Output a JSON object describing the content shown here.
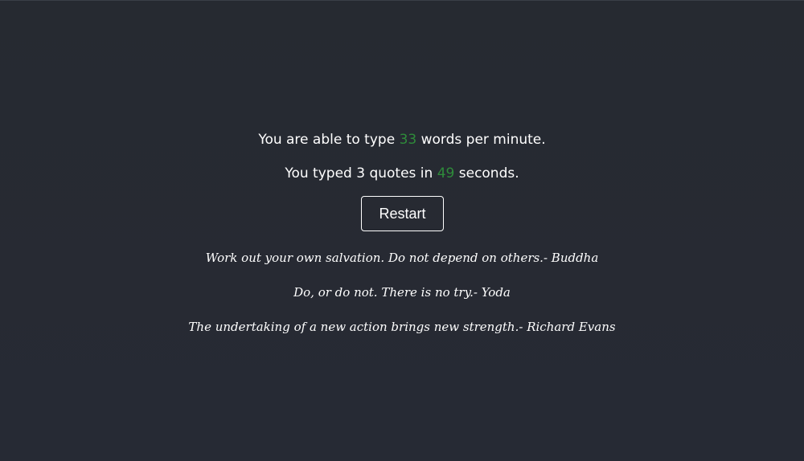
{
  "results": {
    "wpm_prefix": "You are able to type ",
    "wpm_value": "33",
    "wpm_suffix": " words per minute.",
    "time_prefix": "You typed 3 quotes in ",
    "time_value": "49",
    "time_suffix": " seconds."
  },
  "restart_label": "Restart",
  "quotes": [
    {
      "text": "Work out your own salvation. Do not depend on others.",
      "author": "- Buddha"
    },
    {
      "text": "Do, or do not. There is no try.",
      "author": "- Yoda"
    },
    {
      "text": "The undertaking of a new action brings new strength.",
      "author": "- Richard Evans"
    }
  ],
  "colors": {
    "background": "#272a33",
    "accent_number": "#2e8b3a",
    "text": "#ffffff"
  }
}
